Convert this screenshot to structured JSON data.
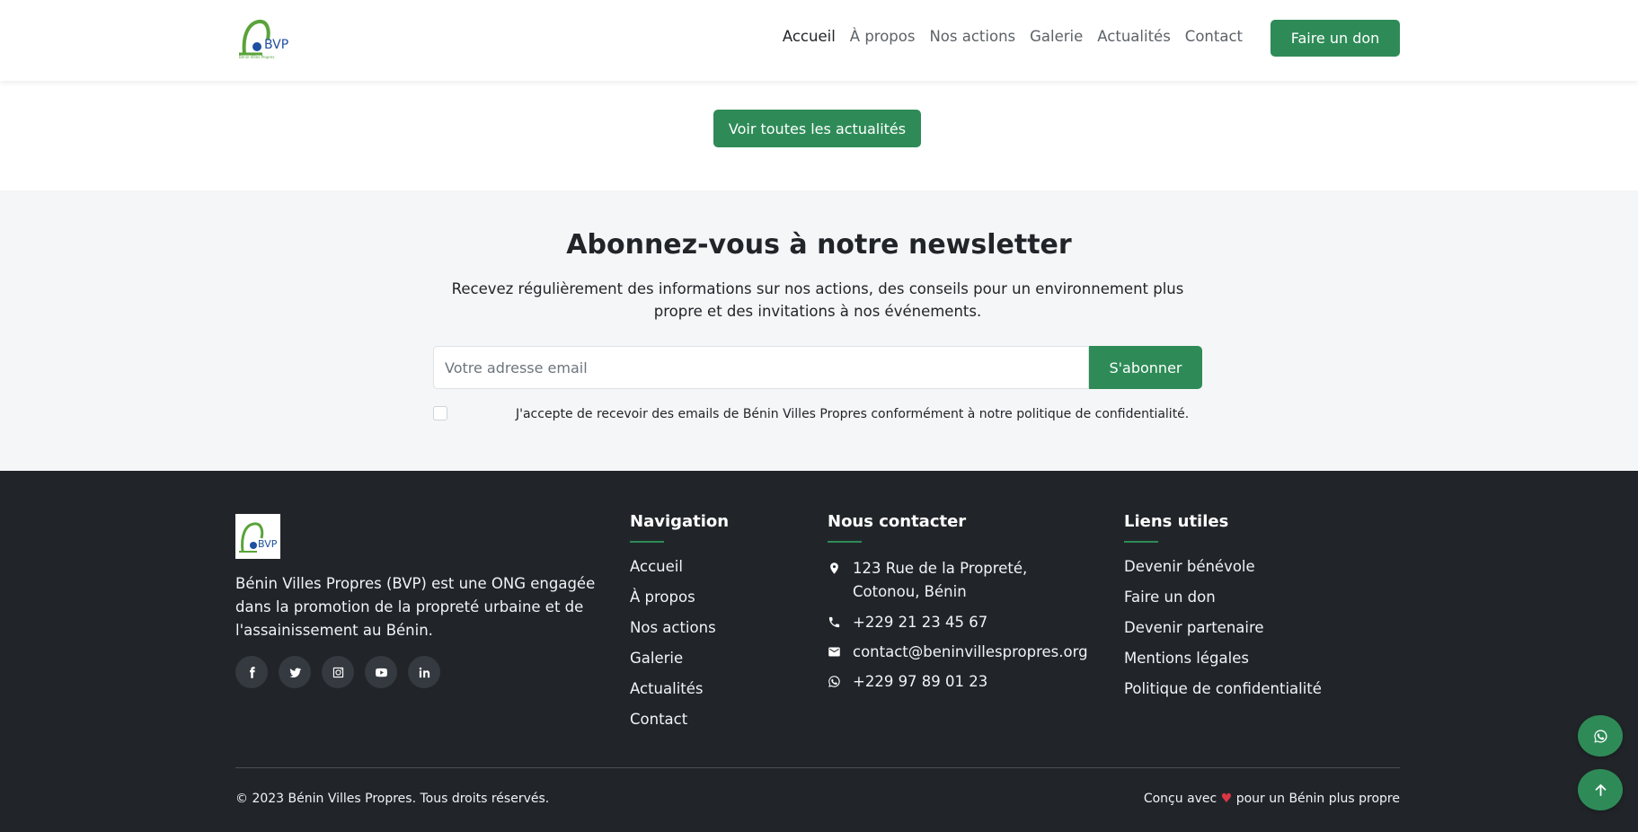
{
  "header": {
    "logo_text": "BVP",
    "nav": [
      "Accueil",
      "À propos",
      "Nos actions",
      "Galerie",
      "Actualités",
      "Contact"
    ],
    "donate_label": "Faire un don"
  },
  "news": {
    "all_label": "Voir toutes les actualités"
  },
  "newsletter": {
    "title": "Abonnez-vous à notre newsletter",
    "text": "Recevez régulièrement des informations sur nos actions, des conseils pour un environnement plus propre et des invitations à nos événements.",
    "email_placeholder": "Votre adresse email",
    "submit_label": "S'abonner",
    "consent": "J'accepte de recevoir des emails de Bénin Villes Propres conformément à notre politique de confidentialité."
  },
  "footer": {
    "about": "Bénin Villes Propres (BVP) est une ONG engagée dans la promotion de la propreté urbaine et de l'assainissement au Bénin.",
    "social_icons": [
      "facebook-icon",
      "twitter-icon",
      "instagram-icon",
      "youtube-icon",
      "linkedin-icon"
    ],
    "nav_title": "Navigation",
    "nav_links": [
      "Accueil",
      "À propos",
      "Nos actions",
      "Galerie",
      "Actualités",
      "Contact"
    ],
    "contact_title": "Nous contacter",
    "address": "123 Rue de la Propreté, Cotonou, Bénin",
    "phone": "+229 21 23 45 67",
    "email": "contact@beninvillespropres.org",
    "whatsapp": "+229 97 89 01 23",
    "useful_title": "Liens utiles",
    "useful_links": [
      "Devenir bénévole",
      "Faire un don",
      "Devenir partenaire",
      "Mentions légales",
      "Politique de confidentialité"
    ],
    "copyright": "© 2023 Bénin Villes Propres. Tous droits réservés.",
    "made_prefix": "Conçu avec",
    "made_suffix": "pour un Bénin plus propre"
  },
  "colors": {
    "accent": "#2e8b57",
    "footer_bg": "#212529",
    "newsletter_bg": "#f5f6f8",
    "heart": "#dc3545"
  }
}
